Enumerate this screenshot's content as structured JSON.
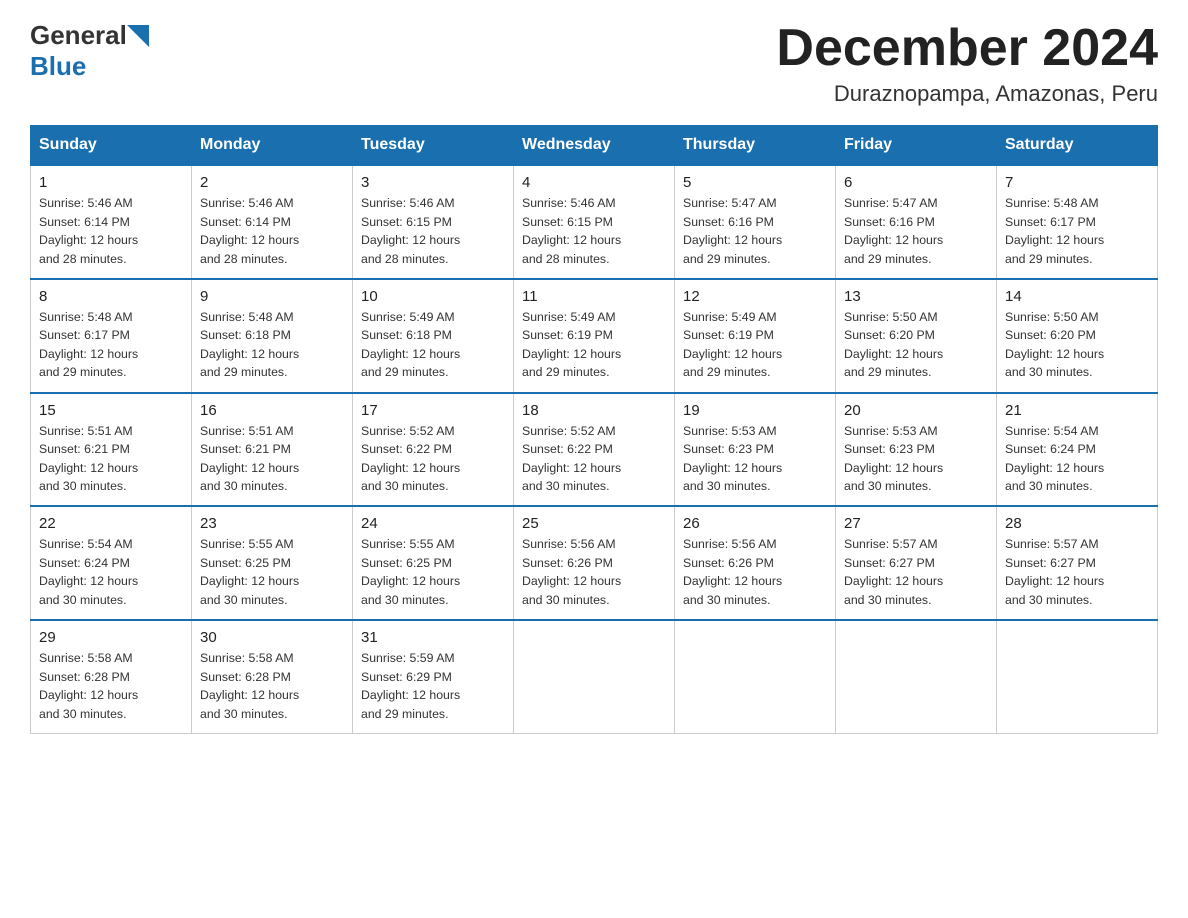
{
  "header": {
    "logo_general": "General",
    "logo_blue": "Blue",
    "title": "December 2024",
    "location": "Duraznopampa, Amazonas, Peru"
  },
  "days_of_week": [
    "Sunday",
    "Monday",
    "Tuesday",
    "Wednesday",
    "Thursday",
    "Friday",
    "Saturday"
  ],
  "weeks": [
    [
      {
        "day": "1",
        "sunrise": "5:46 AM",
        "sunset": "6:14 PM",
        "daylight": "12 hours and 28 minutes."
      },
      {
        "day": "2",
        "sunrise": "5:46 AM",
        "sunset": "6:14 PM",
        "daylight": "12 hours and 28 minutes."
      },
      {
        "day": "3",
        "sunrise": "5:46 AM",
        "sunset": "6:15 PM",
        "daylight": "12 hours and 28 minutes."
      },
      {
        "day": "4",
        "sunrise": "5:46 AM",
        "sunset": "6:15 PM",
        "daylight": "12 hours and 28 minutes."
      },
      {
        "day": "5",
        "sunrise": "5:47 AM",
        "sunset": "6:16 PM",
        "daylight": "12 hours and 29 minutes."
      },
      {
        "day": "6",
        "sunrise": "5:47 AM",
        "sunset": "6:16 PM",
        "daylight": "12 hours and 29 minutes."
      },
      {
        "day": "7",
        "sunrise": "5:48 AM",
        "sunset": "6:17 PM",
        "daylight": "12 hours and 29 minutes."
      }
    ],
    [
      {
        "day": "8",
        "sunrise": "5:48 AM",
        "sunset": "6:17 PM",
        "daylight": "12 hours and 29 minutes."
      },
      {
        "day": "9",
        "sunrise": "5:48 AM",
        "sunset": "6:18 PM",
        "daylight": "12 hours and 29 minutes."
      },
      {
        "day": "10",
        "sunrise": "5:49 AM",
        "sunset": "6:18 PM",
        "daylight": "12 hours and 29 minutes."
      },
      {
        "day": "11",
        "sunrise": "5:49 AM",
        "sunset": "6:19 PM",
        "daylight": "12 hours and 29 minutes."
      },
      {
        "day": "12",
        "sunrise": "5:49 AM",
        "sunset": "6:19 PM",
        "daylight": "12 hours and 29 minutes."
      },
      {
        "day": "13",
        "sunrise": "5:50 AM",
        "sunset": "6:20 PM",
        "daylight": "12 hours and 29 minutes."
      },
      {
        "day": "14",
        "sunrise": "5:50 AM",
        "sunset": "6:20 PM",
        "daylight": "12 hours and 30 minutes."
      }
    ],
    [
      {
        "day": "15",
        "sunrise": "5:51 AM",
        "sunset": "6:21 PM",
        "daylight": "12 hours and 30 minutes."
      },
      {
        "day": "16",
        "sunrise": "5:51 AM",
        "sunset": "6:21 PM",
        "daylight": "12 hours and 30 minutes."
      },
      {
        "day": "17",
        "sunrise": "5:52 AM",
        "sunset": "6:22 PM",
        "daylight": "12 hours and 30 minutes."
      },
      {
        "day": "18",
        "sunrise": "5:52 AM",
        "sunset": "6:22 PM",
        "daylight": "12 hours and 30 minutes."
      },
      {
        "day": "19",
        "sunrise": "5:53 AM",
        "sunset": "6:23 PM",
        "daylight": "12 hours and 30 minutes."
      },
      {
        "day": "20",
        "sunrise": "5:53 AM",
        "sunset": "6:23 PM",
        "daylight": "12 hours and 30 minutes."
      },
      {
        "day": "21",
        "sunrise": "5:54 AM",
        "sunset": "6:24 PM",
        "daylight": "12 hours and 30 minutes."
      }
    ],
    [
      {
        "day": "22",
        "sunrise": "5:54 AM",
        "sunset": "6:24 PM",
        "daylight": "12 hours and 30 minutes."
      },
      {
        "day": "23",
        "sunrise": "5:55 AM",
        "sunset": "6:25 PM",
        "daylight": "12 hours and 30 minutes."
      },
      {
        "day": "24",
        "sunrise": "5:55 AM",
        "sunset": "6:25 PM",
        "daylight": "12 hours and 30 minutes."
      },
      {
        "day": "25",
        "sunrise": "5:56 AM",
        "sunset": "6:26 PM",
        "daylight": "12 hours and 30 minutes."
      },
      {
        "day": "26",
        "sunrise": "5:56 AM",
        "sunset": "6:26 PM",
        "daylight": "12 hours and 30 minutes."
      },
      {
        "day": "27",
        "sunrise": "5:57 AM",
        "sunset": "6:27 PM",
        "daylight": "12 hours and 30 minutes."
      },
      {
        "day": "28",
        "sunrise": "5:57 AM",
        "sunset": "6:27 PM",
        "daylight": "12 hours and 30 minutes."
      }
    ],
    [
      {
        "day": "29",
        "sunrise": "5:58 AM",
        "sunset": "6:28 PM",
        "daylight": "12 hours and 30 minutes."
      },
      {
        "day": "30",
        "sunrise": "5:58 AM",
        "sunset": "6:28 PM",
        "daylight": "12 hours and 30 minutes."
      },
      {
        "day": "31",
        "sunrise": "5:59 AM",
        "sunset": "6:29 PM",
        "daylight": "12 hours and 29 minutes."
      },
      null,
      null,
      null,
      null
    ]
  ],
  "labels": {
    "sunrise": "Sunrise:",
    "sunset": "Sunset:",
    "daylight": "Daylight: 12 hours"
  },
  "colors": {
    "header_bg": "#1a6faf",
    "border_accent": "#1a6faf"
  }
}
